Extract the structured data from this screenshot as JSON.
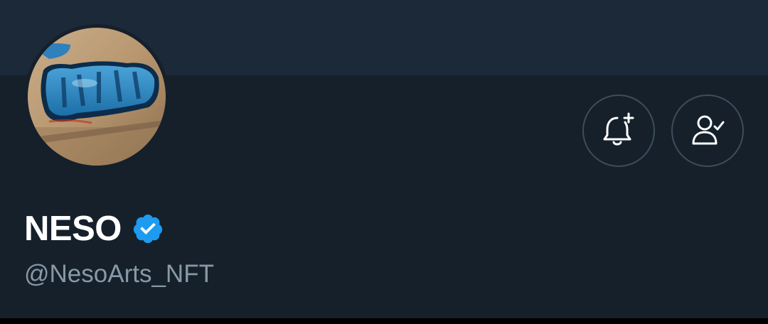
{
  "profile": {
    "display_name": "NESO",
    "handle": "@NesoArts_NFT",
    "verified_icon": "verified-badge-icon",
    "avatar_icon": "graffiti-avatar-image"
  },
  "actions": [
    {
      "icon": "bell-plus-icon"
    },
    {
      "icon": "user-check-icon"
    }
  ],
  "colors": {
    "background": "#15202b",
    "banner": "#1c2938",
    "button_border": "#3d4d5c",
    "name_text": "#ffffff",
    "handle_text": "#8899a6",
    "verified_blue": "#1d9bf0"
  }
}
